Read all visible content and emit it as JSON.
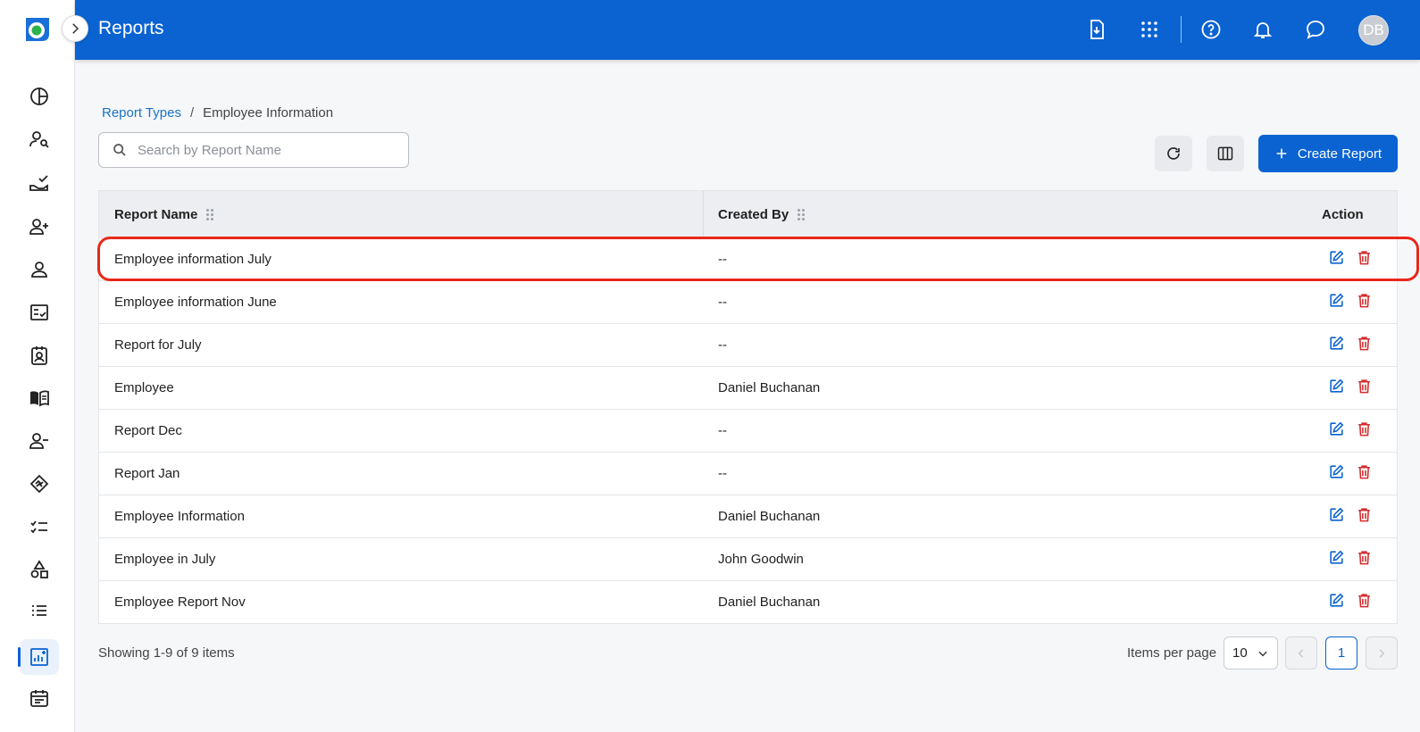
{
  "header": {
    "title": "Reports",
    "avatar_initials": "DB",
    "icons": [
      "file-download-icon",
      "apps-grid-icon",
      "help-icon",
      "bell-icon",
      "chat-icon"
    ]
  },
  "sidebar": {
    "icons": [
      "dashboard-icon",
      "user-search-icon",
      "hand-check-icon",
      "user-add-icon",
      "user-icon",
      "checklist-icon",
      "id-badge-icon",
      "book-icon",
      "user-remove-icon",
      "handshake-icon",
      "task-list-icon",
      "shapes-icon",
      "list-icon",
      "report-chart-icon",
      "calendar-icon"
    ],
    "active": "report-chart-icon"
  },
  "breadcrumb": {
    "link": "Report Types",
    "separator": "/",
    "current": "Employee Information"
  },
  "search": {
    "placeholder": "Search by Report Name",
    "value": ""
  },
  "toolbar": {
    "create_label": "Create Report"
  },
  "table": {
    "headers": {
      "name": "Report Name",
      "created_by": "Created By",
      "action": "Action"
    },
    "rows": [
      {
        "name": "Employee information July",
        "created_by": "--"
      },
      {
        "name": "Employee information June",
        "created_by": "--"
      },
      {
        "name": "Report for July",
        "created_by": "--"
      },
      {
        "name": "Employee",
        "created_by": "Daniel Buchanan"
      },
      {
        "name": "Report Dec",
        "created_by": "--"
      },
      {
        "name": "Report Jan",
        "created_by": "--"
      },
      {
        "name": "Employee Information",
        "created_by": "Daniel Buchanan"
      },
      {
        "name": "Employee in July",
        "created_by": "John Goodwin"
      },
      {
        "name": "Employee Report Nov",
        "created_by": "Daniel Buchanan"
      }
    ]
  },
  "pagination": {
    "showing": "Showing 1-9 of 9 items",
    "items_per_page_label": "Items per page",
    "items_per_page": "10",
    "current_page": "1"
  },
  "colors": {
    "primary": "#0a63d1",
    "delete": "#d42b2b",
    "highlight": "#e8281a"
  }
}
